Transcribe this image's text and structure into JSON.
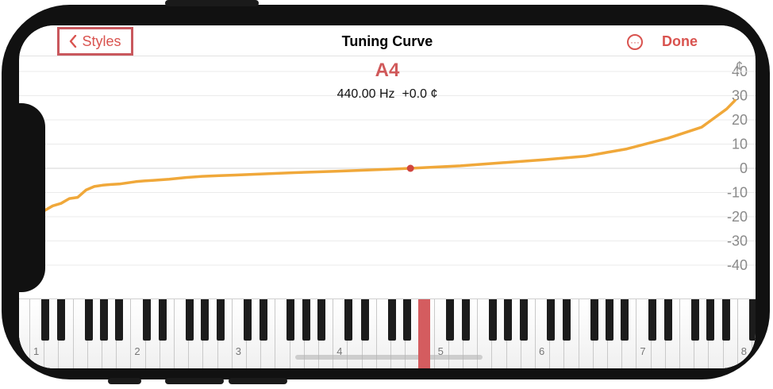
{
  "navbar": {
    "back_label": "Styles",
    "title": "Tuning Curve",
    "more_icon": "ellipsis-circle-icon",
    "done_label": "Done"
  },
  "note": {
    "name": "A4",
    "frequency": "440.00 Hz",
    "cents": "+0.0 ¢"
  },
  "colors": {
    "accent": "#d9534f",
    "curve": "#f0a83a",
    "selected_key": "#d45c5f"
  },
  "chart_data": {
    "type": "line",
    "ylabel": "¢",
    "ylim": [
      -50,
      50
    ],
    "yticks": [
      40,
      30,
      20,
      10,
      0,
      -10,
      -20,
      -30,
      -40
    ],
    "grid": true,
    "x_unit": "piano key (1-88)",
    "series": [
      {
        "x": [
          1,
          2,
          3,
          4,
          5,
          6,
          7,
          8,
          9,
          10,
          11,
          12,
          13,
          14,
          15,
          16,
          17,
          18,
          20,
          22,
          24,
          26,
          28,
          30,
          35,
          40,
          45,
          49,
          55,
          60,
          65,
          70,
          75,
          80,
          84,
          87,
          88
        ],
        "values": [
          -23,
          -22,
          -21,
          -20,
          -17.5,
          -15.5,
          -14.5,
          -12.5,
          -12,
          -9,
          -7.5,
          -7,
          -6.7,
          -6.5,
          -6,
          -5.5,
          -5.2,
          -5,
          -4.5,
          -3.8,
          -3.3,
          -3,
          -2.8,
          -2.5,
          -1.8,
          -1.2,
          -0.6,
          0,
          1,
          2.3,
          3.5,
          5,
          8,
          12.5,
          17,
          24.5,
          28
        ]
      }
    ],
    "highlight_point": {
      "x": 49,
      "y": 0
    }
  },
  "keyboard": {
    "octave_labels": [
      "1",
      "2",
      "3",
      "4",
      "5",
      "6",
      "7",
      "8"
    ],
    "selected_key": "A4"
  }
}
